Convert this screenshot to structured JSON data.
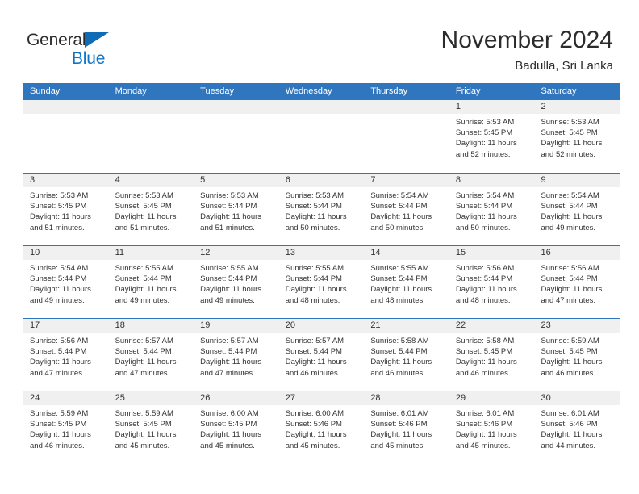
{
  "brand": {
    "name_part1": "General",
    "name_part2": "Blue",
    "triangle_icon": "blue-triangle-logo-mark",
    "colors": {
      "text_dark": "#2b2b2b",
      "blue": "#1175c4",
      "triangle": "#0f6cb6"
    }
  },
  "header": {
    "title": "November 2024",
    "subtitle": "Badulla, Sri Lanka"
  },
  "theme": {
    "header_blue": "#3076be",
    "row_separator": "#3076be",
    "day_number_band": "#f0f0f0",
    "text": "#333333"
  },
  "calendar": {
    "weekdays": [
      "Sunday",
      "Monday",
      "Tuesday",
      "Wednesday",
      "Thursday",
      "Friday",
      "Saturday"
    ],
    "weeks": [
      [
        {
          "day": "",
          "empty": true
        },
        {
          "day": "",
          "empty": true
        },
        {
          "day": "",
          "empty": true
        },
        {
          "day": "",
          "empty": true
        },
        {
          "day": "",
          "empty": true
        },
        {
          "day": "1",
          "sunrise": "Sunrise: 5:53 AM",
          "sunset": "Sunset: 5:45 PM",
          "daylight": "Daylight: 11 hours and 52 minutes."
        },
        {
          "day": "2",
          "sunrise": "Sunrise: 5:53 AM",
          "sunset": "Sunset: 5:45 PM",
          "daylight": "Daylight: 11 hours and 52 minutes."
        }
      ],
      [
        {
          "day": "3",
          "sunrise": "Sunrise: 5:53 AM",
          "sunset": "Sunset: 5:45 PM",
          "daylight": "Daylight: 11 hours and 51 minutes."
        },
        {
          "day": "4",
          "sunrise": "Sunrise: 5:53 AM",
          "sunset": "Sunset: 5:45 PM",
          "daylight": "Daylight: 11 hours and 51 minutes."
        },
        {
          "day": "5",
          "sunrise": "Sunrise: 5:53 AM",
          "sunset": "Sunset: 5:44 PM",
          "daylight": "Daylight: 11 hours and 51 minutes."
        },
        {
          "day": "6",
          "sunrise": "Sunrise: 5:53 AM",
          "sunset": "Sunset: 5:44 PM",
          "daylight": "Daylight: 11 hours and 50 minutes."
        },
        {
          "day": "7",
          "sunrise": "Sunrise: 5:54 AM",
          "sunset": "Sunset: 5:44 PM",
          "daylight": "Daylight: 11 hours and 50 minutes."
        },
        {
          "day": "8",
          "sunrise": "Sunrise: 5:54 AM",
          "sunset": "Sunset: 5:44 PM",
          "daylight": "Daylight: 11 hours and 50 minutes."
        },
        {
          "day": "9",
          "sunrise": "Sunrise: 5:54 AM",
          "sunset": "Sunset: 5:44 PM",
          "daylight": "Daylight: 11 hours and 49 minutes."
        }
      ],
      [
        {
          "day": "10",
          "sunrise": "Sunrise: 5:54 AM",
          "sunset": "Sunset: 5:44 PM",
          "daylight": "Daylight: 11 hours and 49 minutes."
        },
        {
          "day": "11",
          "sunrise": "Sunrise: 5:55 AM",
          "sunset": "Sunset: 5:44 PM",
          "daylight": "Daylight: 11 hours and 49 minutes."
        },
        {
          "day": "12",
          "sunrise": "Sunrise: 5:55 AM",
          "sunset": "Sunset: 5:44 PM",
          "daylight": "Daylight: 11 hours and 49 minutes."
        },
        {
          "day": "13",
          "sunrise": "Sunrise: 5:55 AM",
          "sunset": "Sunset: 5:44 PM",
          "daylight": "Daylight: 11 hours and 48 minutes."
        },
        {
          "day": "14",
          "sunrise": "Sunrise: 5:55 AM",
          "sunset": "Sunset: 5:44 PM",
          "daylight": "Daylight: 11 hours and 48 minutes."
        },
        {
          "day": "15",
          "sunrise": "Sunrise: 5:56 AM",
          "sunset": "Sunset: 5:44 PM",
          "daylight": "Daylight: 11 hours and 48 minutes."
        },
        {
          "day": "16",
          "sunrise": "Sunrise: 5:56 AM",
          "sunset": "Sunset: 5:44 PM",
          "daylight": "Daylight: 11 hours and 47 minutes."
        }
      ],
      [
        {
          "day": "17",
          "sunrise": "Sunrise: 5:56 AM",
          "sunset": "Sunset: 5:44 PM",
          "daylight": "Daylight: 11 hours and 47 minutes."
        },
        {
          "day": "18",
          "sunrise": "Sunrise: 5:57 AM",
          "sunset": "Sunset: 5:44 PM",
          "daylight": "Daylight: 11 hours and 47 minutes."
        },
        {
          "day": "19",
          "sunrise": "Sunrise: 5:57 AM",
          "sunset": "Sunset: 5:44 PM",
          "daylight": "Daylight: 11 hours and 47 minutes."
        },
        {
          "day": "20",
          "sunrise": "Sunrise: 5:57 AM",
          "sunset": "Sunset: 5:44 PM",
          "daylight": "Daylight: 11 hours and 46 minutes."
        },
        {
          "day": "21",
          "sunrise": "Sunrise: 5:58 AM",
          "sunset": "Sunset: 5:44 PM",
          "daylight": "Daylight: 11 hours and 46 minutes."
        },
        {
          "day": "22",
          "sunrise": "Sunrise: 5:58 AM",
          "sunset": "Sunset: 5:45 PM",
          "daylight": "Daylight: 11 hours and 46 minutes."
        },
        {
          "day": "23",
          "sunrise": "Sunrise: 5:59 AM",
          "sunset": "Sunset: 5:45 PM",
          "daylight": "Daylight: 11 hours and 46 minutes."
        }
      ],
      [
        {
          "day": "24",
          "sunrise": "Sunrise: 5:59 AM",
          "sunset": "Sunset: 5:45 PM",
          "daylight": "Daylight: 11 hours and 46 minutes."
        },
        {
          "day": "25",
          "sunrise": "Sunrise: 5:59 AM",
          "sunset": "Sunset: 5:45 PM",
          "daylight": "Daylight: 11 hours and 45 minutes."
        },
        {
          "day": "26",
          "sunrise": "Sunrise: 6:00 AM",
          "sunset": "Sunset: 5:45 PM",
          "daylight": "Daylight: 11 hours and 45 minutes."
        },
        {
          "day": "27",
          "sunrise": "Sunrise: 6:00 AM",
          "sunset": "Sunset: 5:46 PM",
          "daylight": "Daylight: 11 hours and 45 minutes."
        },
        {
          "day": "28",
          "sunrise": "Sunrise: 6:01 AM",
          "sunset": "Sunset: 5:46 PM",
          "daylight": "Daylight: 11 hours and 45 minutes."
        },
        {
          "day": "29",
          "sunrise": "Sunrise: 6:01 AM",
          "sunset": "Sunset: 5:46 PM",
          "daylight": "Daylight: 11 hours and 45 minutes."
        },
        {
          "day": "30",
          "sunrise": "Sunrise: 6:01 AM",
          "sunset": "Sunset: 5:46 PM",
          "daylight": "Daylight: 11 hours and 44 minutes."
        }
      ]
    ]
  }
}
